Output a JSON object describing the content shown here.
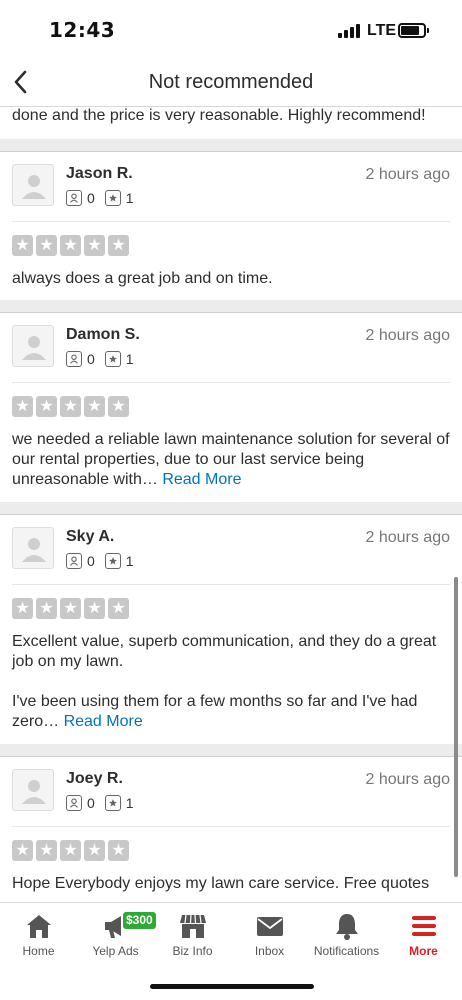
{
  "status_bar": {
    "time": "12:43",
    "network": "LTE"
  },
  "header": {
    "title": "Not recommended"
  },
  "previous_text": "done and the price is very reasonable. Highly recommend!",
  "reviews": [
    {
      "name": "Jason R.",
      "friends": "0",
      "reviews": "1",
      "time": "2 hours ago",
      "rating": 5,
      "text": "always does a great job and on time.",
      "read_more": "",
      "text2": ""
    },
    {
      "name": "Damon S.",
      "friends": "0",
      "reviews": "1",
      "time": "2 hours ago",
      "rating": 5,
      "text": "we needed a reliable lawn maintenance solution for several of our rental properties, due to our last service being unreasonable with…",
      "read_more": "Read More",
      "text2": ""
    },
    {
      "name": "Sky A.",
      "friends": "0",
      "reviews": "1",
      "time": "2 hours ago",
      "rating": 5,
      "text": "Excellent value, superb communication, and they do a great job on my lawn.",
      "text2": "I've been using them for a few months so far and I've had zero…",
      "read_more": "Read More"
    },
    {
      "name": "Joey R.",
      "friends": "0",
      "reviews": "1",
      "time": "2 hours ago",
      "rating": 5,
      "text": "Hope Everybody enjoys my lawn care service. Free quotes",
      "read_more": "",
      "text2": ""
    }
  ],
  "tab_bar": {
    "tabs": [
      {
        "label": "Home",
        "icon": "home-icon"
      },
      {
        "label": "Yelp Ads",
        "icon": "megaphone-icon",
        "badge": "$300"
      },
      {
        "label": "Biz Info",
        "icon": "storefront-icon"
      },
      {
        "label": "Inbox",
        "icon": "envelope-icon"
      },
      {
        "label": "Notifications",
        "icon": "bell-icon"
      },
      {
        "label": "More",
        "icon": "menu-icon"
      }
    ],
    "active": "More",
    "colors": {
      "active": "#d32323",
      "inactive": "#555555",
      "badge": "#2fa835",
      "link": "#0073bb"
    }
  }
}
